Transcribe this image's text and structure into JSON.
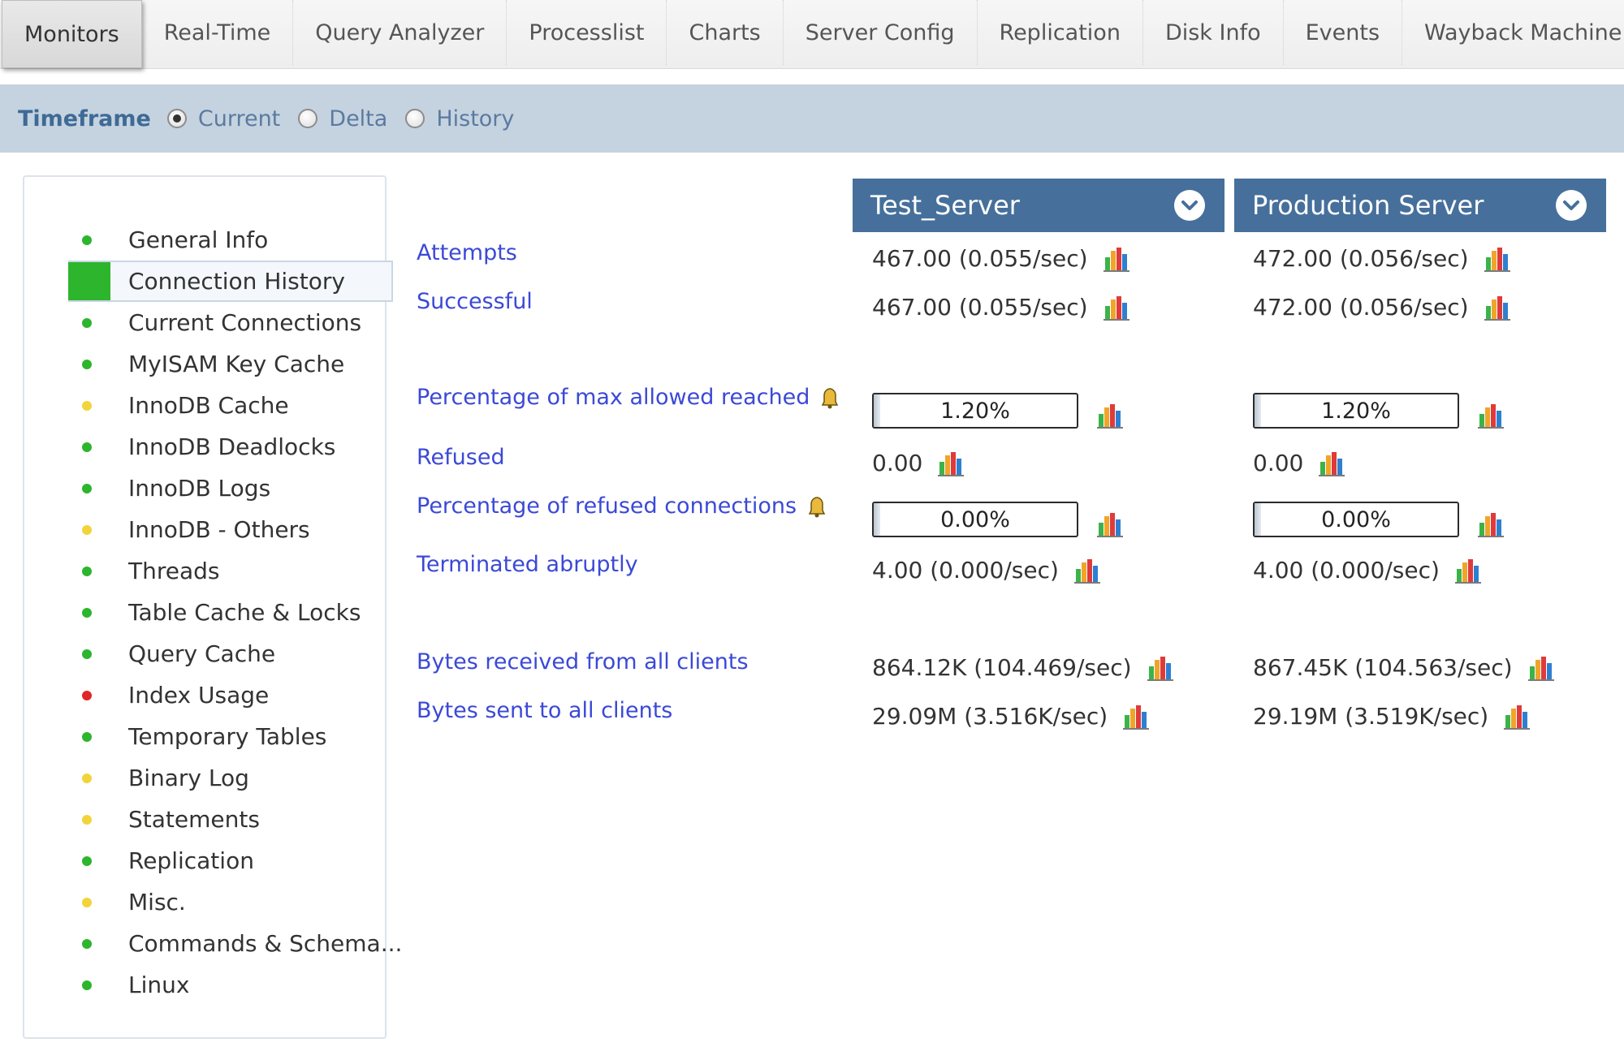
{
  "tabs": [
    {
      "label": "Monitors",
      "active": true
    },
    {
      "label": "Real-Time"
    },
    {
      "label": "Query Analyzer"
    },
    {
      "label": "Processlist"
    },
    {
      "label": "Charts"
    },
    {
      "label": "Server Config"
    },
    {
      "label": "Replication"
    },
    {
      "label": "Disk Info"
    },
    {
      "label": "Events"
    },
    {
      "label": "Wayback Machine"
    }
  ],
  "timeframe": {
    "label": "Timeframe",
    "options": [
      {
        "label": "Current",
        "checked": true
      },
      {
        "label": "Delta",
        "checked": false
      },
      {
        "label": "History",
        "checked": false
      }
    ]
  },
  "colors": {
    "green": "#2db52d",
    "yellow": "#f2d43a",
    "red": "#e02727",
    "header_blue": "#46709b",
    "link_blue": "#3b49d6"
  },
  "sidebar": {
    "items": [
      {
        "label": "General Info",
        "status": "green"
      },
      {
        "label": "Connection History",
        "status": "green",
        "active": true
      },
      {
        "label": "Current Connections",
        "status": "green"
      },
      {
        "label": "MyISAM Key Cache",
        "status": "green"
      },
      {
        "label": "InnoDB Cache",
        "status": "yellow"
      },
      {
        "label": "InnoDB Deadlocks",
        "status": "green"
      },
      {
        "label": "InnoDB Logs",
        "status": "green"
      },
      {
        "label": "InnoDB - Others",
        "status": "yellow"
      },
      {
        "label": "Threads",
        "status": "green"
      },
      {
        "label": "Table Cache & Locks",
        "status": "green"
      },
      {
        "label": "Query Cache",
        "status": "green"
      },
      {
        "label": "Index Usage",
        "status": "red"
      },
      {
        "label": "Temporary Tables",
        "status": "green"
      },
      {
        "label": "Binary Log",
        "status": "yellow"
      },
      {
        "label": "Statements",
        "status": "yellow"
      },
      {
        "label": "Replication",
        "status": "green"
      },
      {
        "label": "Misc.",
        "status": "yellow"
      },
      {
        "label": "Commands & Schema...",
        "status": "green"
      },
      {
        "label": "Linux",
        "status": "green"
      }
    ]
  },
  "servers": [
    {
      "name": "Test_Server",
      "attempts": "467.00 (0.055/sec)",
      "successful": "467.00 (0.055/sec)",
      "pct_max_allowed": "1.20%",
      "pct_max_allowed_fraction": 0.012,
      "refused": "0.00",
      "pct_refused": "0.00%",
      "pct_refused_fraction": 0.0,
      "terminated": "4.00 (0.000/sec)",
      "bytes_received": "864.12K (104.469/sec)",
      "bytes_sent": "29.09M (3.516K/sec)"
    },
    {
      "name": "Production Server",
      "attempts": "472.00 (0.056/sec)",
      "successful": "472.00 (0.056/sec)",
      "pct_max_allowed": "1.20%",
      "pct_max_allowed_fraction": 0.012,
      "refused": "0.00",
      "pct_refused": "0.00%",
      "pct_refused_fraction": 0.0,
      "terminated": "4.00 (0.000/sec)",
      "bytes_received": "867.45K (104.563/sec)",
      "bytes_sent": "29.19M (3.519K/sec)"
    }
  ],
  "metrics": {
    "attempts": "Attempts",
    "successful": "Successful",
    "pct_max_allowed": "Percentage of max allowed reached",
    "refused": "Refused",
    "pct_refused": "Percentage of refused connections",
    "terminated": "Terminated abruptly",
    "bytes_received": "Bytes received from all clients",
    "bytes_sent": "Bytes sent to all clients"
  },
  "icons": {
    "chart": "bar-chart-icon",
    "alert": "bell-icon",
    "dropdown": "chevron-down-icon"
  }
}
